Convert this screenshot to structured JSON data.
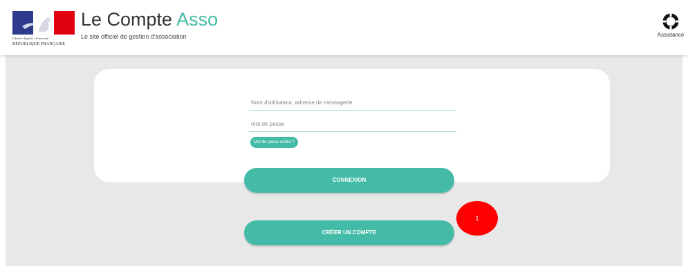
{
  "header": {
    "motto": "Liberté • Égalité • Fraternité",
    "republic": "RÉPUBLIQUE FRANÇAISE",
    "title_main": "Le Compte ",
    "title_accent": "Asso",
    "tagline": "Le site officiel de gestion d'association",
    "assistance_label": "Assistance"
  },
  "login": {
    "username_placeholder": "Nom d'utilisateur, adresse de messagerie",
    "password_placeholder": "mot de passe",
    "forgot_label": "Mot de passe oublié ?",
    "connect_label": "CONNEXION",
    "create_label": "CRÉER UN COMPTE"
  },
  "annotation": {
    "step_number": "1"
  },
  "colors": {
    "accent": "#44bba6",
    "badge": "#ff0000",
    "background": "#e8e8e8",
    "flag_blue": "#2e3a8c",
    "flag_red": "#e1000f"
  }
}
